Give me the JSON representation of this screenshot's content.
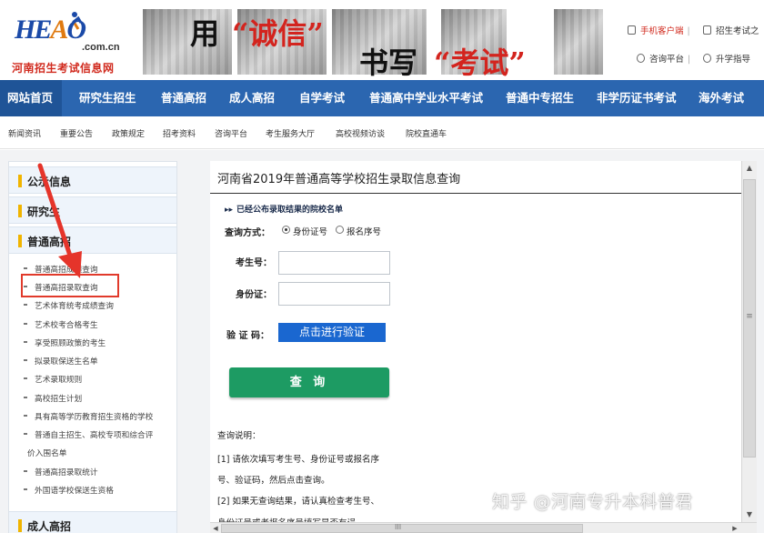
{
  "header": {
    "logo": {
      "mark_a": "HE",
      "mark_b": "A",
      "mark_c": "O",
      "domain": ".com.cn",
      "name": "河南招生考试信息网"
    },
    "banner": {
      "t1": "用",
      "t2": "“诚信”",
      "t3": "书写",
      "t4": "“考试”"
    },
    "quick_links": {
      "mobile": "手机客户端",
      "guide": "招生考试之",
      "consult": "咨询平台",
      "forum": "升学指导"
    }
  },
  "main_nav": [
    "网站首页",
    "研究生招生",
    "普通高招",
    "成人高招",
    "自学考试",
    "普通高中学业水平考试",
    "普通中专招生",
    "非学历证书考试",
    "海外考试"
  ],
  "sub_nav": [
    "新闻资讯",
    "重要公告",
    "政策规定",
    "招考资料",
    "咨询平台",
    "考生服务大厅",
    "高校视频访谈",
    "院校直通车"
  ],
  "sidebar": {
    "sections": [
      "公示信息",
      "研究生",
      "普通高招",
      "成人高招"
    ],
    "items": [
      "普通高招成绩查询",
      "普通高招录取查询",
      "艺术体育统考成绩查询",
      "艺术校考合格考生",
      "享受照顾政策的考生",
      "拟录取保送生名单",
      "艺术录取规则",
      "高校招生计划",
      "具有高等学历教育招生资格的学校",
      "普通自主招生、高校专项和综合评",
      "价入围名单",
      "普通高招录取统计",
      "外国语学校保送生资格"
    ]
  },
  "panel": {
    "title": "河南省2019年普通高等学校招生录取信息查询",
    "notice_arrow": "▸▸",
    "notice": "已经公布录取结果的院校名单",
    "query_method_label": "查询方式：",
    "radio_id": "身份证号",
    "radio_reg": "报名序号",
    "exam_no_label": "考生号：",
    "id_label": "身份证：",
    "captcha_label": "验 证 码：",
    "verify_button": "点击进行验证",
    "query_button": "查 询",
    "help_title": "查询说明：",
    "help_lines": [
      "[1] 请依次填写考生号、身份证号或报名序",
      "号、验证码，然后点击查询。",
      "[2] 如果无查询结果，请认真检查考生号、",
      "身份证号或者报名序号填写是否有误。"
    ]
  },
  "scrollbar": {
    "up": "▲",
    "down": "▼",
    "left": "◀",
    "right": "▶",
    "grip": "≡",
    "hgrip": "III"
  },
  "watermark": "知乎 @河南专升本科普君",
  "colors": {
    "nav_bg": "#2b66b0",
    "query_button": "#1d9b63",
    "verify_button": "#1a67d0",
    "highlight": "#e13a2b",
    "brand_red": "#d12a1e"
  }
}
